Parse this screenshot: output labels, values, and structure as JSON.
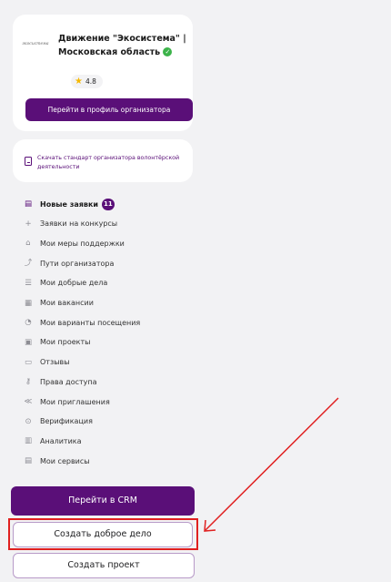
{
  "organizer": {
    "logo_text": "экосистема",
    "name_line1": "Движение \"Экосистема\" |",
    "name_line2": "Московская область",
    "rating": "4.8",
    "profile_button": "Перейти в профиль организатора"
  },
  "download": {
    "text": "Скачать стандарт организатора волонтёрской деятельности"
  },
  "menu": {
    "items": [
      {
        "label": "Новые заявки",
        "badge": "11",
        "icon": "applications-icon"
      },
      {
        "label": "Заявки на конкурсы",
        "icon": "plus-icon"
      },
      {
        "label": "Мои меры поддержки",
        "icon": "support-icon"
      },
      {
        "label": "Пути организатора",
        "icon": "path-icon"
      },
      {
        "label": "Мои добрые дела",
        "icon": "list-icon"
      },
      {
        "label": "Мои вакансии",
        "icon": "vacancy-icon"
      },
      {
        "label": "Мои варианты посещения",
        "icon": "visit-icon"
      },
      {
        "label": "Мои проекты",
        "icon": "projects-icon"
      },
      {
        "label": "Отзывы",
        "icon": "reviews-icon"
      },
      {
        "label": "Права доступа",
        "icon": "key-icon"
      },
      {
        "label": "Мои приглашения",
        "icon": "share-icon"
      },
      {
        "label": "Верификация",
        "icon": "verify-icon"
      },
      {
        "label": "Аналитика",
        "icon": "analytics-icon"
      },
      {
        "label": "Мои сервисы",
        "icon": "services-icon"
      }
    ]
  },
  "buttons": {
    "crm": "Перейти в CRM",
    "create_good_deed": "Создать доброе дело",
    "create_project": "Создать проект"
  },
  "colors": {
    "accent": "#5a0f78",
    "highlight": "#e02020",
    "verified": "#3cb34a",
    "star": "#f5b800"
  }
}
